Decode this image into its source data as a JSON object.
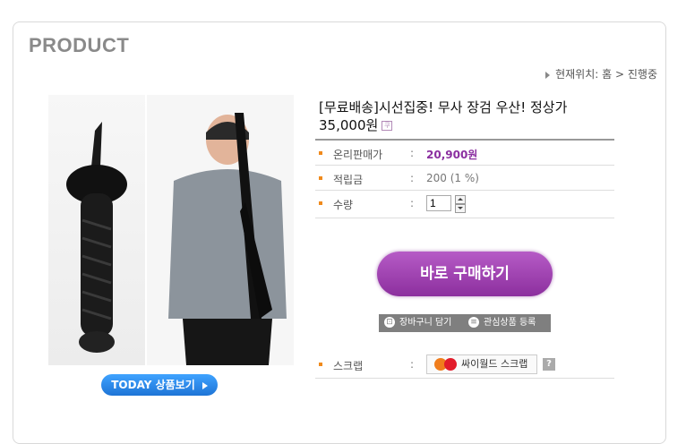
{
  "header": {
    "title": "PRODUCT"
  },
  "breadcrumb": {
    "label": "현재위치:",
    "path": "홈 > 진행중"
  },
  "gallery": {
    "today_button": "TODAY 상품보기"
  },
  "product": {
    "title": "[무료배송]시선집중! 무사 장검 우산! 정상가 35,000원",
    "coupon_icon": "coupon-icon",
    "rows": [
      {
        "label": "온리판매가",
        "value": "20,900원"
      },
      {
        "label": "적립금",
        "value": "200 (1 %)"
      },
      {
        "label": "수량",
        "value": "1"
      }
    ]
  },
  "actions": {
    "buy_now": "바로 구매하기",
    "add_cart": "장바구니 담기",
    "add_wishlist": "관심상품 등록"
  },
  "scrap": {
    "label": "스크랩",
    "cyworld": "싸이월드 스크랩",
    "help": "?"
  },
  "colors": {
    "accent": "#8c2f9e",
    "bullet": "#f08a1c",
    "today_blue": "#1e74d6"
  }
}
